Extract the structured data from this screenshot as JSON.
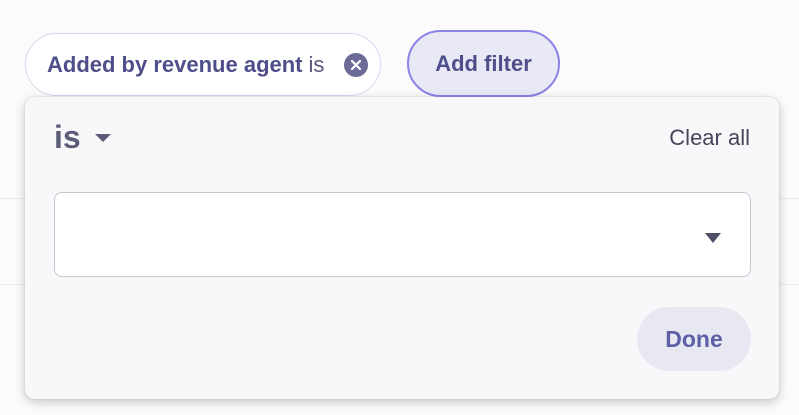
{
  "filter_bar": {
    "chip": {
      "field": "Added by revenue agent",
      "operator": "is",
      "clear_icon": "close-circle-icon"
    },
    "add_filter_label": "Add filter"
  },
  "popover": {
    "operator_value": "is",
    "operator_icon": "caret-down-icon",
    "clear_all_label": "Clear all",
    "value_select": {
      "value": "",
      "icon": "caret-down-icon"
    },
    "done_label": "Done"
  },
  "colors": {
    "accent": "#8b83e6",
    "chip_text": "#4e4f8a",
    "done_text": "#5e60a6",
    "popover_bg": "#f8f8fb"
  }
}
